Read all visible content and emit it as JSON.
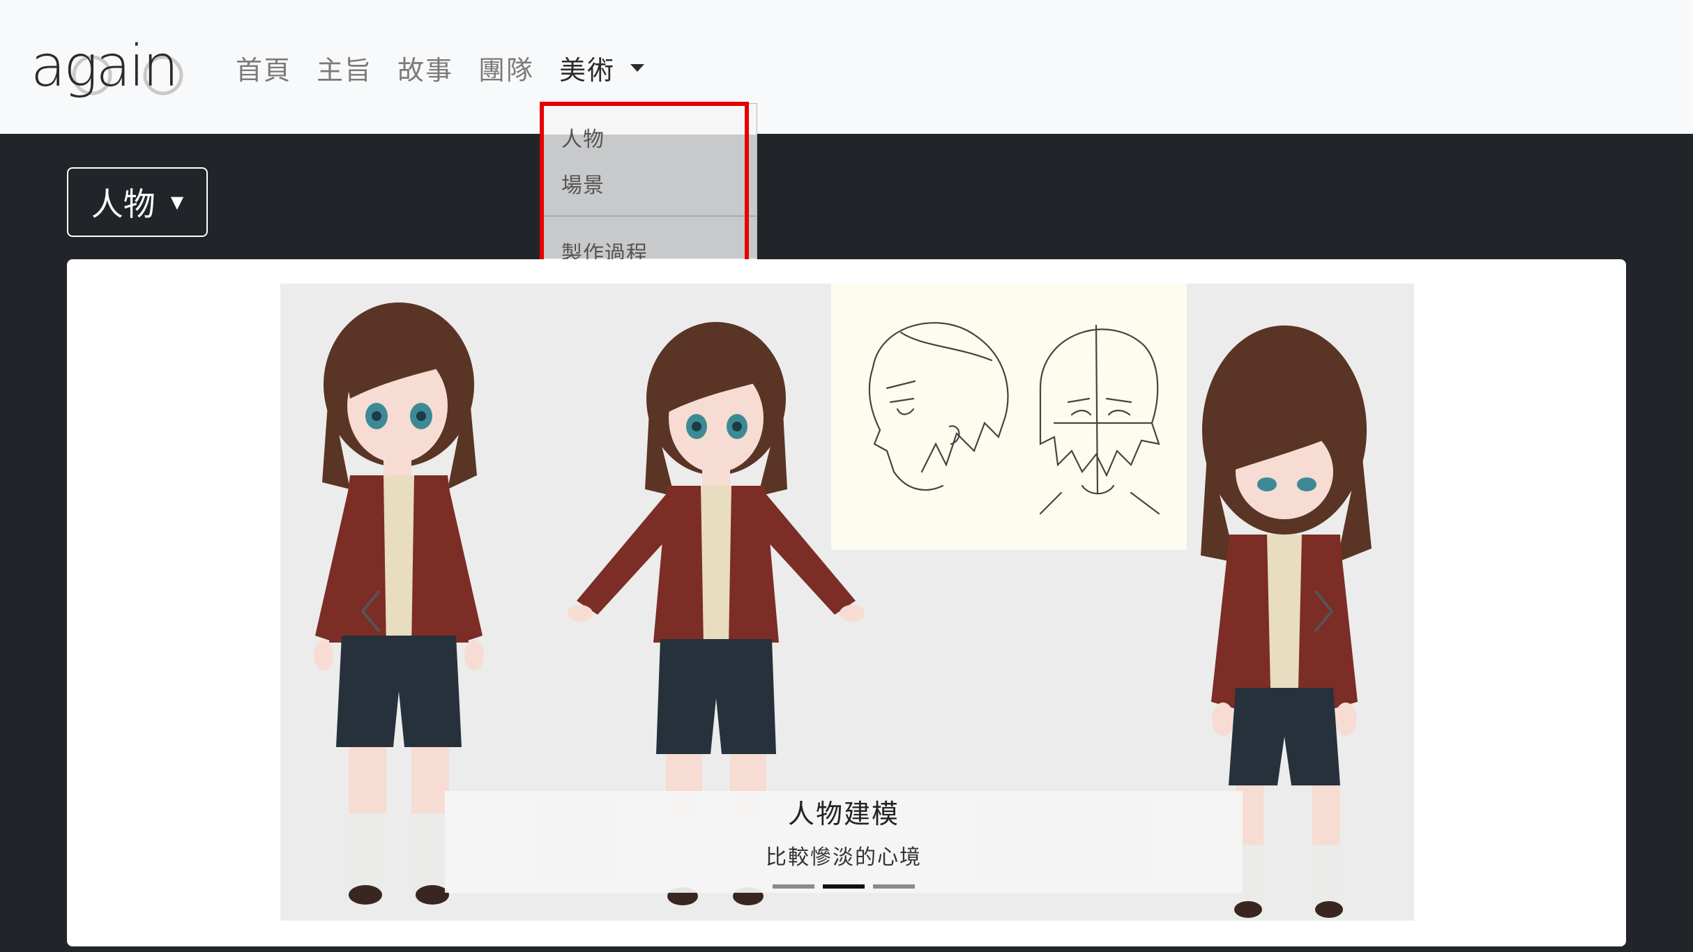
{
  "brand": {
    "logo_text": "again"
  },
  "nav": {
    "items": [
      {
        "label": "首頁"
      },
      {
        "label": "主旨"
      },
      {
        "label": "故事"
      },
      {
        "label": "團隊"
      }
    ],
    "active_label": "美術"
  },
  "dropdown": {
    "items": [
      {
        "label": "人物"
      },
      {
        "label": "場景"
      },
      {
        "label": "製作過程"
      }
    ],
    "highlight_color": "#e50000"
  },
  "category_button": {
    "label": "人物",
    "caret": "▼"
  },
  "carousel": {
    "caption_title": "人物建模",
    "caption_subtitle": "比較慘淡的心境",
    "slide_count": 3,
    "active_slide": 2,
    "prev_icon": "chevron-left-icon",
    "next_icon": "chevron-right-icon"
  },
  "colors": {
    "page_bg": "#212529",
    "navbar_bg": "#f8f9fa",
    "jacket": "#7b2d26",
    "hair": "#5a3424",
    "shorts": "#26313b"
  }
}
